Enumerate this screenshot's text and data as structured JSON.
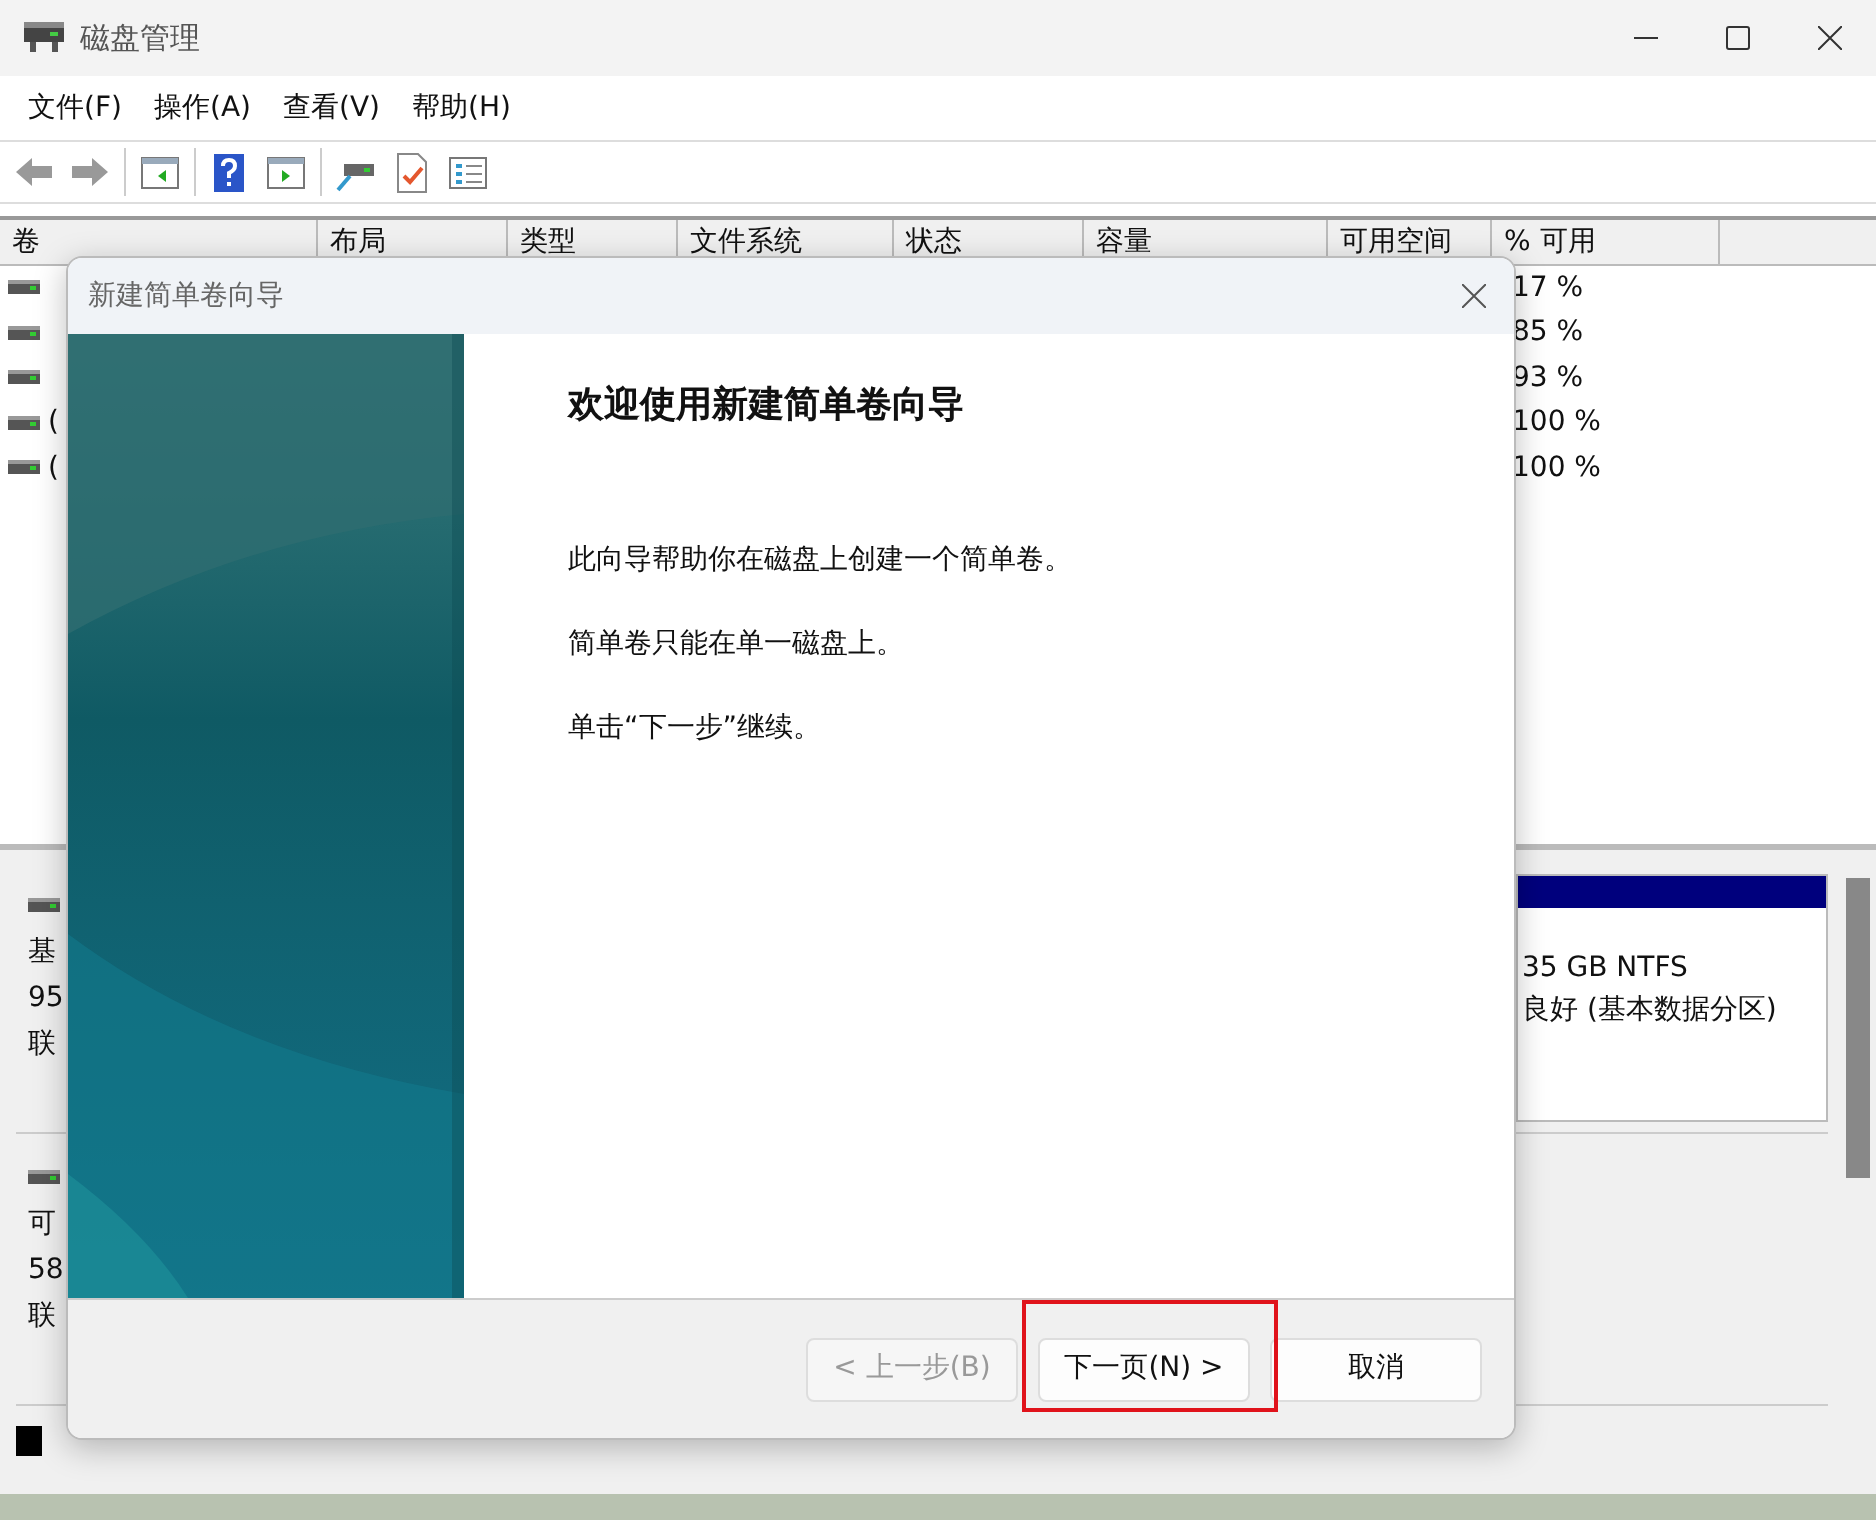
{
  "window": {
    "title": "磁盘管理"
  },
  "menu": [
    "文件(F)",
    "操作(A)",
    "查看(V)",
    "帮助(H)"
  ],
  "volume_table": {
    "columns": [
      "卷",
      "布局",
      "类型",
      "文件系统",
      "状态",
      "容量",
      "可用空间",
      "% 可用"
    ],
    "rows": [
      {
        "percent_free": "17 %"
      },
      {
        "percent_free": "85 %"
      },
      {
        "percent_free": "93 %"
      },
      {
        "volume": "(",
        "percent_free": "100 %"
      },
      {
        "volume": "(",
        "percent_free": "100 %"
      }
    ]
  },
  "disks": [
    {
      "lines": [
        "基",
        "95",
        "联"
      ],
      "partition": {
        "lines": [
          "35 GB NTFS",
          "良好 (基本数据分区)"
        ]
      }
    },
    {
      "lines": [
        "可",
        "58",
        "联"
      ]
    }
  ],
  "dialog": {
    "title": "新建简单卷向导",
    "heading": "欢迎使用新建简单卷向导",
    "paragraphs": [
      "此向导帮助你在磁盘上创建一个简单卷。",
      "简单卷只能在单一磁盘上。",
      "单击“下一步”继续。"
    ],
    "buttons": [
      {
        "label": "< 上一步(B)",
        "disabled": true,
        "highlighted": false
      },
      {
        "label": "下一页(N) >",
        "disabled": false,
        "highlighted": true
      },
      {
        "label": "取消",
        "disabled": false,
        "highlighted": false
      }
    ]
  }
}
